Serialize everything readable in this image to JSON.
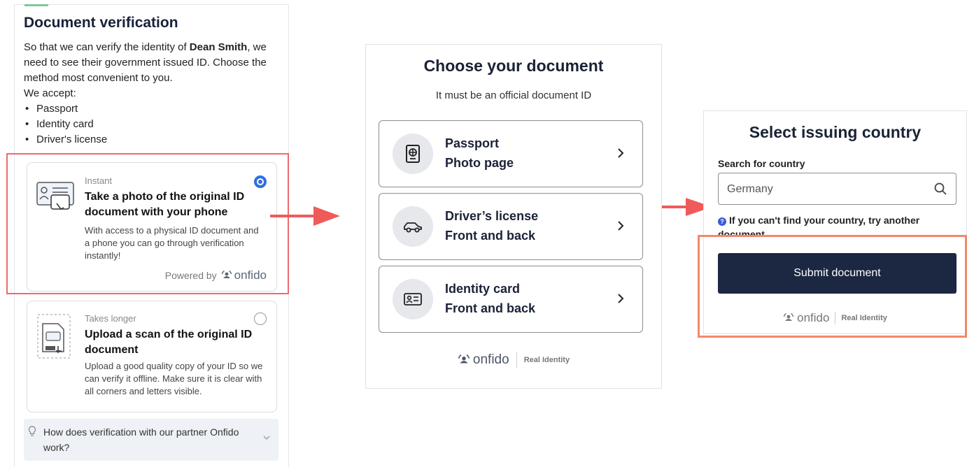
{
  "panel1": {
    "title": "Document verification",
    "intro_before_name": "So that we can verify the identity of ",
    "intro_name": "Dean Smith",
    "intro_after_name": ", we need to see their government issued ID. Choose the method most convenient to you.",
    "accept_label": "We accept:",
    "accepted": [
      "Passport",
      "Identity card",
      "Driver's license"
    ],
    "option_instant": {
      "tag": "Instant",
      "title": "Take a photo of the original ID document with your phone",
      "desc": "With access to a physical ID document and a phone you can go through verification instantly!",
      "powered_by": "Powered by",
      "brand": "onfido",
      "selected": true
    },
    "option_upload": {
      "tag": "Takes longer",
      "title": "Upload a scan of the original ID document",
      "desc": "Upload a good quality copy of your ID so we can verify it offline. Make sure it is clear with all corners and letters visible.",
      "selected": false
    },
    "faq": "How does verification with our partner Onfido work?"
  },
  "panel2": {
    "title": "Choose your document",
    "subtitle": "It must be an official document ID",
    "documents": [
      {
        "line1": "Passport",
        "line2": "Photo page",
        "icon": "passport-icon"
      },
      {
        "line1": "Driver’s license",
        "line2": "Front and back",
        "icon": "car-icon"
      },
      {
        "line1": "Identity card",
        "line2": "Front and back",
        "icon": "id-card-icon"
      }
    ],
    "brand": "onfido",
    "tagline": "Real Identity"
  },
  "panel3": {
    "title": "Select issuing country",
    "search_label": "Search for country",
    "search_value": "Germany",
    "hint": "If you can't find your country, try another document",
    "submit": "Submit document",
    "brand": "onfido",
    "tagline": "Real Identity"
  },
  "colors": {
    "accent_blue": "#2f6fe0",
    "dark_button": "#1c2741",
    "arrow_red": "#ef5a5a",
    "highlight_red": "#ef6b6b",
    "highlight_orange": "#f2876d"
  }
}
